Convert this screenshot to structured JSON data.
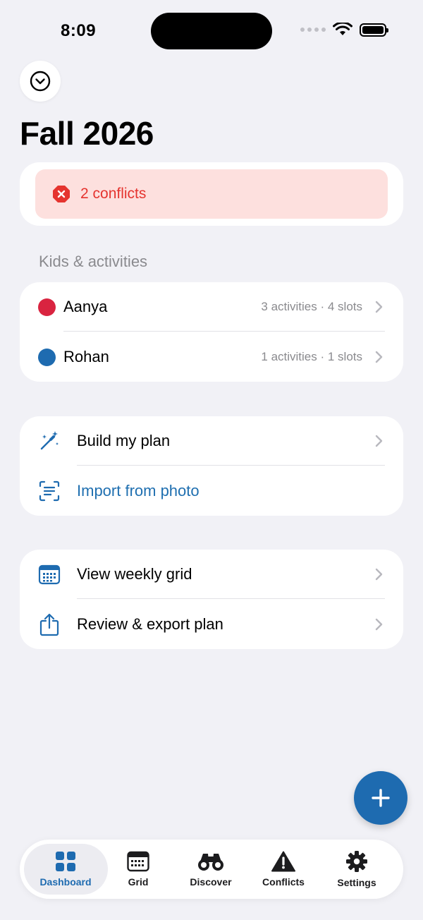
{
  "status_bar": {
    "time": "8:09"
  },
  "header": {
    "title": "Fall 2026"
  },
  "conflicts_banner": {
    "text": "2 conflicts",
    "color": "#e5342f"
  },
  "kids_section": {
    "label": "Kids & activities",
    "kids": [
      {
        "name": "Aanya",
        "meta": "3 activities · 4 slots",
        "color": "#d92440"
      },
      {
        "name": "Rohan",
        "meta": "1 activities · 1 slots",
        "color": "#1e6bb0"
      }
    ]
  },
  "plan_actions": {
    "build": {
      "label": "Build my plan",
      "icon": "magic-wand-icon"
    },
    "import": {
      "label": "Import from photo",
      "icon": "text-scan-icon"
    }
  },
  "view_actions": {
    "grid": {
      "label": "View weekly grid",
      "icon": "calendar-icon"
    },
    "export": {
      "label": "Review & export plan",
      "icon": "share-icon"
    }
  },
  "tabbar": {
    "tabs": [
      {
        "label": "Dashboard",
        "icon": "dashboard-grid-icon",
        "active": true
      },
      {
        "label": "Grid",
        "icon": "calendar-grid-icon",
        "active": false
      },
      {
        "label": "Discover",
        "icon": "binoculars-icon",
        "active": false
      },
      {
        "label": "Conflicts",
        "icon": "warning-triangle-icon",
        "active": false
      },
      {
        "label": "Settings",
        "icon": "gear-icon",
        "active": false
      }
    ]
  },
  "colors": {
    "accent": "#1e6bb0",
    "background": "#f1f1f6",
    "danger": "#e5342f"
  }
}
